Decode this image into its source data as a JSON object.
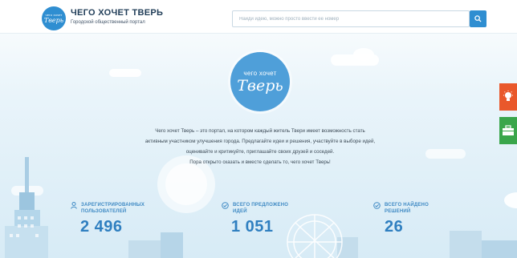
{
  "header": {
    "logo_small": "чего хочет",
    "logo_script": "Тверь",
    "title": "ЧЕГО ХОЧЕТ ТВЕРЬ",
    "subtitle": "Городской общественный портал",
    "search_placeholder": "Найди идею, можно просто ввести ее номер"
  },
  "hero": {
    "small": "чего хочет",
    "script": "Тверь"
  },
  "intro": {
    "lines": [
      "Чего хочет Тверь – это портал, на котором каждый житель Твери имеет возможность стать",
      "активным участником улучшения города. Предлагайте идеи и решения, участвуйте в выборе идей,",
      "оценивайте и критикуйте, приглашайте своих друзей и соседей.",
      "Пора открыто сказать и вместе сделать то, чего хочет Тверь!"
    ]
  },
  "stats": [
    {
      "label_line1": "ЗАРЕГИСТРИРОВАННЫХ",
      "label_line2": "ПОЛЬЗОВАТЕЛЕЙ",
      "value": "2 496",
      "icon": "user-icon"
    },
    {
      "label_line1": "ВСЕГО ПРЕДЛОЖЕНО",
      "label_line2": "ИДЕЙ",
      "value": "1 051",
      "icon": "check-circle-icon"
    },
    {
      "label_line1": "ВСЕГО НАЙДЕНО",
      "label_line2": "РЕШЕНИЙ",
      "value": "26",
      "icon": "check-circle-icon"
    }
  ],
  "side_buttons": [
    {
      "icon": "lightbulb-icon",
      "color": "#e9582b"
    },
    {
      "icon": "briefcase-icon",
      "color": "#3aa64b"
    }
  ],
  "colors": {
    "accent": "#2f8ed1",
    "stat_text": "#3f8ac4",
    "stat_number": "#2f7fc0"
  }
}
